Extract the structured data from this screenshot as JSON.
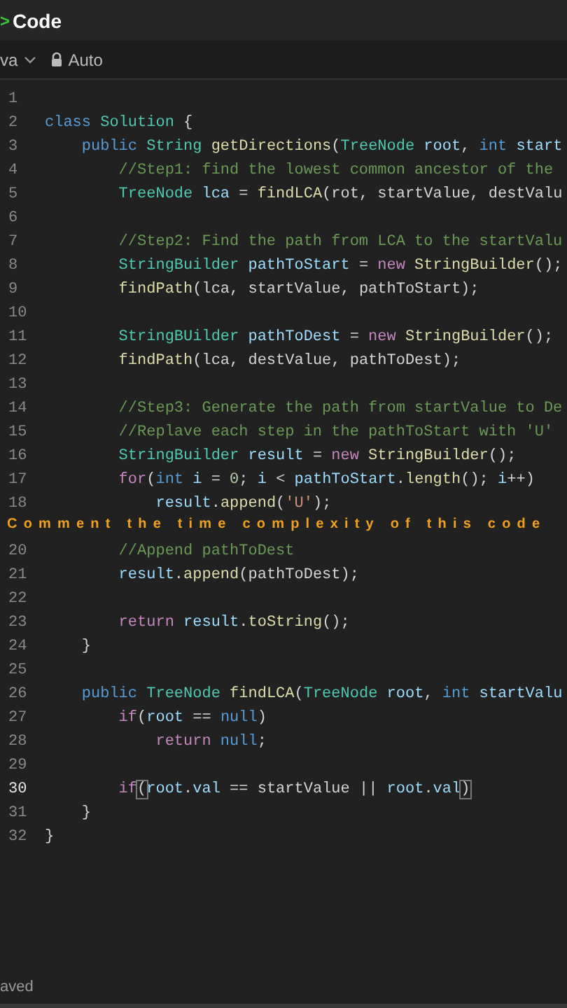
{
  "header": {
    "chevron": ">",
    "title": "Code"
  },
  "toolbar": {
    "language": "va",
    "mode": "Auto"
  },
  "lines": [
    {
      "number": "1",
      "current": false
    },
    {
      "number": "2",
      "current": false,
      "tokens": [
        {
          "kind": "kw",
          "text": "class"
        },
        {
          "kind": "type",
          "text": " Solution"
        },
        {
          "kind": "plain",
          "text": " {"
        }
      ]
    },
    {
      "number": "3",
      "current": false,
      "tokens": [
        {
          "kind": "kw",
          "text": "    public"
        },
        {
          "kind": "type",
          "text": " String"
        },
        {
          "kind": "fn",
          "text": " getDirections"
        },
        {
          "kind": "plain",
          "text": "("
        },
        {
          "kind": "type",
          "text": "TreeNode"
        },
        {
          "kind": "var",
          "text": " root"
        },
        {
          "kind": "plain",
          "text": ","
        },
        {
          "kind": "kw",
          "text": " int"
        },
        {
          "kind": "var",
          "text": " start"
        }
      ]
    },
    {
      "number": "4",
      "current": false,
      "tokens": [
        {
          "kind": "cm",
          "text": "        //Step1: find the lowest common ancestor of the"
        }
      ]
    },
    {
      "number": "5",
      "current": false,
      "tokens": [
        {
          "kind": "type",
          "text": "        TreeNode"
        },
        {
          "kind": "var",
          "text": " lca"
        },
        {
          "kind": "plain",
          "text": " ="
        },
        {
          "kind": "fn",
          "text": " findLCA"
        },
        {
          "kind": "plain",
          "text": "(rot, startValue, destValu"
        }
      ]
    },
    {
      "number": "6",
      "current": false
    },
    {
      "number": "7",
      "current": false,
      "tokens": [
        {
          "kind": "cm",
          "text": "        //Step2: Find the path from LCA to the startValu"
        }
      ]
    },
    {
      "number": "8",
      "current": false,
      "tokens": [
        {
          "kind": "type",
          "text": "        StringBuilder"
        },
        {
          "kind": "var",
          "text": " pathToStart"
        },
        {
          "kind": "plain",
          "text": " ="
        },
        {
          "kind": "ctl",
          "text": " new"
        },
        {
          "kind": "fn",
          "text": " StringBuilder"
        },
        {
          "kind": "plain",
          "text": "();"
        }
      ]
    },
    {
      "number": "9",
      "current": false,
      "tokens": [
        {
          "kind": "fn",
          "text": "        findPath"
        },
        {
          "kind": "plain",
          "text": "(lca, startValue, pathToStart);"
        }
      ]
    },
    {
      "number": "10",
      "current": false
    },
    {
      "number": "11",
      "current": false,
      "tokens": [
        {
          "kind": "type",
          "text": "        StringBUilder"
        },
        {
          "kind": "var",
          "text": " pathToDest"
        },
        {
          "kind": "plain",
          "text": " ="
        },
        {
          "kind": "ctl",
          "text": " new"
        },
        {
          "kind": "fn",
          "text": " StringBuilder"
        },
        {
          "kind": "plain",
          "text": "();"
        }
      ]
    },
    {
      "number": "12",
      "current": false,
      "tokens": [
        {
          "kind": "fn",
          "text": "        findPath"
        },
        {
          "kind": "plain",
          "text": "(lca, destValue, pathToDest);"
        }
      ]
    },
    {
      "number": "13",
      "current": false
    },
    {
      "number": "14",
      "current": false,
      "tokens": [
        {
          "kind": "cm",
          "text": "        //Step3: Generate the path from startValue to De"
        }
      ]
    },
    {
      "number": "15",
      "current": false,
      "tokens": [
        {
          "kind": "cm",
          "text": "        //Replave each step in the pathToStart with 'U'"
        }
      ]
    },
    {
      "number": "16",
      "current": false,
      "tokens": [
        {
          "kind": "type",
          "text": "        StringBuilder"
        },
        {
          "kind": "var",
          "text": " result"
        },
        {
          "kind": "plain",
          "text": " ="
        },
        {
          "kind": "ctl",
          "text": " new"
        },
        {
          "kind": "fn",
          "text": " StringBuilder"
        },
        {
          "kind": "plain",
          "text": "();"
        }
      ]
    },
    {
      "number": "17",
      "current": false,
      "tokens": [
        {
          "kind": "ctl",
          "text": "        for"
        },
        {
          "kind": "plain",
          "text": "("
        },
        {
          "kind": "kw",
          "text": "int"
        },
        {
          "kind": "var",
          "text": " i"
        },
        {
          "kind": "plain",
          "text": " ="
        },
        {
          "kind": "num",
          "text": " 0"
        },
        {
          "kind": "plain",
          "text": ";"
        },
        {
          "kind": "var",
          "text": " i"
        },
        {
          "kind": "plain",
          "text": " <"
        },
        {
          "kind": "var",
          "text": " pathToStart"
        },
        {
          "kind": "plain",
          "text": "."
        },
        {
          "kind": "fn",
          "text": "length"
        },
        {
          "kind": "plain",
          "text": "();"
        },
        {
          "kind": "var",
          "text": " i"
        },
        {
          "kind": "plain",
          "text": "++)"
        }
      ]
    },
    {
      "number": "18",
      "current": false,
      "tokens": [
        {
          "kind": "var",
          "text": "            result"
        },
        {
          "kind": "plain",
          "text": "."
        },
        {
          "kind": "fn",
          "text": "append"
        },
        {
          "kind": "plain",
          "text": "("
        },
        {
          "kind": "str",
          "text": "'U'"
        },
        {
          "kind": "plain",
          "text": ");"
        }
      ]
    },
    {
      "caption": "Comment the time complexity of this code"
    },
    {
      "number": "20",
      "current": false,
      "tokens": [
        {
          "kind": "cm",
          "text": "        //Append pathToDest"
        }
      ]
    },
    {
      "number": "21",
      "current": false,
      "tokens": [
        {
          "kind": "var",
          "text": "        result"
        },
        {
          "kind": "plain",
          "text": "."
        },
        {
          "kind": "fn",
          "text": "append"
        },
        {
          "kind": "plain",
          "text": "(pathToDest);"
        }
      ]
    },
    {
      "number": "22",
      "current": false
    },
    {
      "number": "23",
      "current": false,
      "tokens": [
        {
          "kind": "ctl",
          "text": "        return"
        },
        {
          "kind": "var",
          "text": " result"
        },
        {
          "kind": "plain",
          "text": "."
        },
        {
          "kind": "fn",
          "text": "toString"
        },
        {
          "kind": "plain",
          "text": "();"
        }
      ]
    },
    {
      "number": "24",
      "current": false,
      "tokens": [
        {
          "kind": "plain",
          "text": "    }"
        }
      ]
    },
    {
      "number": "25",
      "current": false
    },
    {
      "number": "26",
      "current": false,
      "tokens": [
        {
          "kind": "kw",
          "text": "    public"
        },
        {
          "kind": "type",
          "text": " TreeNode"
        },
        {
          "kind": "fn",
          "text": " findLCA"
        },
        {
          "kind": "plain",
          "text": "("
        },
        {
          "kind": "type",
          "text": "TreeNode"
        },
        {
          "kind": "var",
          "text": " root"
        },
        {
          "kind": "plain",
          "text": ","
        },
        {
          "kind": "kw",
          "text": " int"
        },
        {
          "kind": "var",
          "text": " startValu"
        }
      ]
    },
    {
      "number": "27",
      "current": false,
      "tokens": [
        {
          "kind": "ctl",
          "text": "        if"
        },
        {
          "kind": "plain",
          "text": "("
        },
        {
          "kind": "var",
          "text": "root"
        },
        {
          "kind": "plain",
          "text": " =="
        },
        {
          "kind": "kw",
          "text": " null"
        },
        {
          "kind": "plain",
          "text": ")"
        }
      ]
    },
    {
      "number": "28",
      "current": false,
      "tokens": [
        {
          "kind": "ctl",
          "text": "            return"
        },
        {
          "kind": "kw",
          "text": " null"
        },
        {
          "kind": "plain",
          "text": ";"
        }
      ]
    },
    {
      "number": "29",
      "current": false
    },
    {
      "number": "30",
      "current": true,
      "tokens": [
        {
          "kind": "ctl",
          "text": "        if"
        },
        {
          "kind": "match",
          "text": "("
        },
        {
          "kind": "var",
          "text": "root"
        },
        {
          "kind": "plain",
          "text": "."
        },
        {
          "kind": "var",
          "text": "val"
        },
        {
          "kind": "plain",
          "text": " == startValue ||"
        },
        {
          "kind": "var",
          "text": " root"
        },
        {
          "kind": "plain",
          "text": "."
        },
        {
          "kind": "var",
          "text": "val"
        },
        {
          "kind": "match",
          "text": ")"
        }
      ]
    },
    {
      "number": "31",
      "current": false,
      "tokens": [
        {
          "kind": "plain",
          "text": "    }"
        }
      ]
    },
    {
      "number": "32",
      "current": false,
      "tokens": [
        {
          "kind": "plain",
          "text": "}"
        }
      ]
    }
  ],
  "status": "aved"
}
